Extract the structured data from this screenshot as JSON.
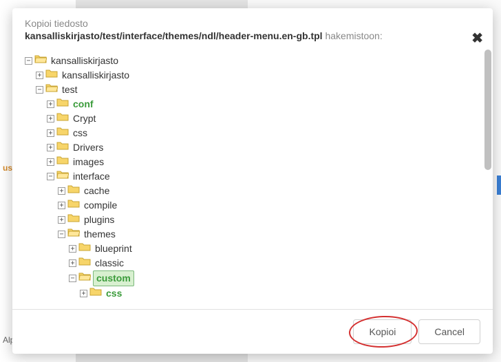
{
  "bg": {
    "word1": "us",
    "word2": "AlphaBrowse"
  },
  "header": {
    "title": "Kopioi tiedosto",
    "path": "kansalliskirjasto/test/interface/themes/ndl/header-menu.en-gb.tpl",
    "path_suffix": " hakemistoon:"
  },
  "tree": {
    "root": {
      "label": "kansalliskirjasto",
      "children": [
        {
          "label": "kansalliskirjasto",
          "expanded": false
        },
        {
          "label": "test",
          "expanded": true,
          "children": [
            {
              "label": "conf",
              "green": true,
              "expanded": false
            },
            {
              "label": "Crypt",
              "expanded": false
            },
            {
              "label": "css",
              "expanded": false
            },
            {
              "label": "Drivers",
              "expanded": false
            },
            {
              "label": "images",
              "expanded": false
            },
            {
              "label": "interface",
              "expanded": true,
              "children": [
                {
                  "label": "cache",
                  "expanded": false
                },
                {
                  "label": "compile",
                  "expanded": false
                },
                {
                  "label": "plugins",
                  "expanded": false
                },
                {
                  "label": "themes",
                  "expanded": true,
                  "children": [
                    {
                      "label": "blueprint",
                      "expanded": false
                    },
                    {
                      "label": "classic",
                      "expanded": false
                    },
                    {
                      "label": "custom",
                      "green": true,
                      "highlighted": true,
                      "expanded": true,
                      "children": [
                        {
                          "label": "css",
                          "green": true,
                          "expanded": false
                        }
                      ]
                    }
                  ]
                }
              ]
            }
          ]
        }
      ]
    }
  },
  "footer": {
    "copy": "Kopioi",
    "cancel": "Cancel"
  }
}
